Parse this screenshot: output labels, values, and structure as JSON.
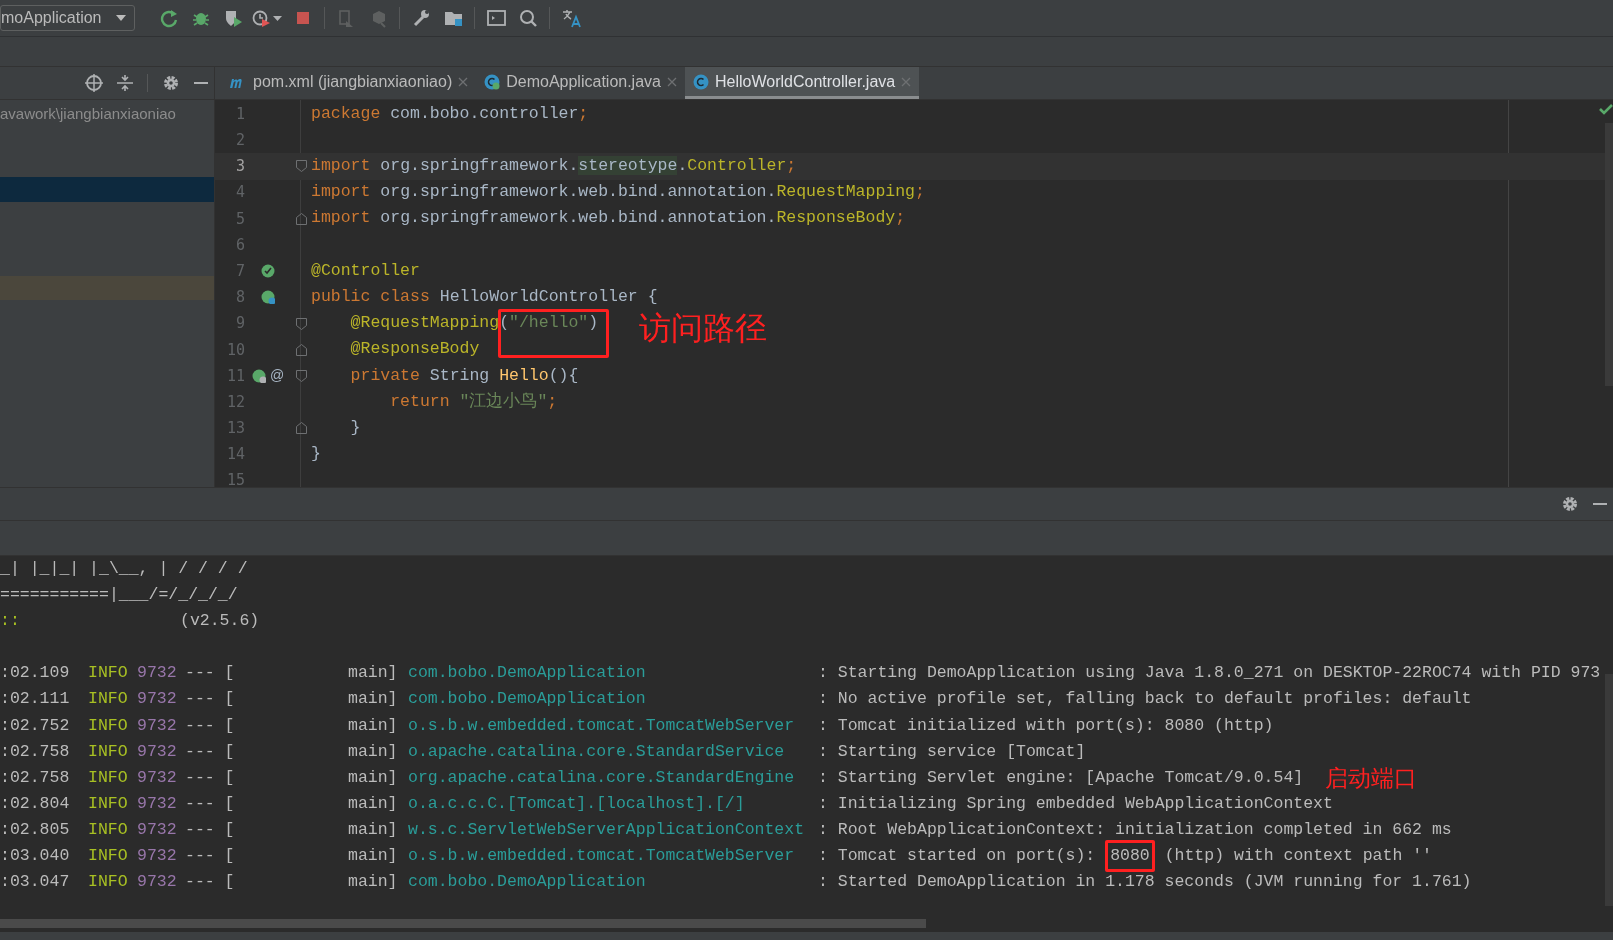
{
  "toolbar": {
    "run_config": "moApplication",
    "tools": [
      {
        "kind": "rerun"
      },
      {
        "kind": "debug"
      },
      {
        "kind": "coverage"
      },
      {
        "kind": "profile"
      },
      {
        "kind": "stop"
      },
      {
        "kind": "sep"
      },
      {
        "kind": "attach"
      },
      {
        "kind": "deploy"
      },
      {
        "kind": "sep"
      },
      {
        "kind": "wrench"
      },
      {
        "kind": "folder"
      },
      {
        "kind": "sep"
      },
      {
        "kind": "terminal"
      },
      {
        "kind": "search"
      },
      {
        "kind": "sep"
      },
      {
        "kind": "translate"
      }
    ]
  },
  "project_panel": {
    "path": "avawork\\jiangbianxiaoniao"
  },
  "tabs": [
    {
      "label": "pom.xml (jiangbianxiaoniao)",
      "kind": "maven",
      "selected": false
    },
    {
      "label": "DemoApplication.java",
      "kind": "app",
      "selected": false
    },
    {
      "label": "HelloWorldController.java",
      "kind": "class",
      "selected": true
    }
  ],
  "code": [
    {
      "number": "1",
      "current": false,
      "tokens": [
        {
          "kind": "keyword",
          "text": "package"
        },
        {
          "kind": "plain",
          "text": " com.bobo.controller"
        },
        {
          "kind": "keyword",
          "text": ";"
        }
      ]
    },
    {
      "number": "2",
      "current": false
    },
    {
      "number": "3",
      "current": true,
      "markers": [
        {
          "kind": "fold-start"
        }
      ],
      "tokens": [
        {
          "kind": "keyword",
          "text": "import"
        },
        {
          "kind": "plain",
          "text": " org.springframework."
        },
        {
          "kind": "match",
          "text": "stereotype"
        },
        {
          "kind": "plain",
          "text": "."
        },
        {
          "kind": "type",
          "text": "Controller"
        },
        {
          "kind": "keyword",
          "text": ";"
        }
      ]
    },
    {
      "number": "4",
      "current": false,
      "tokens": [
        {
          "kind": "keyword",
          "text": "import"
        },
        {
          "kind": "plain",
          "text": " org.springframework.web.bind.annotation."
        },
        {
          "kind": "type",
          "text": "RequestMapping"
        },
        {
          "kind": "keyword",
          "text": ";"
        }
      ]
    },
    {
      "number": "5",
      "current": false,
      "markers": [
        {
          "kind": "fold-end"
        }
      ],
      "tokens": [
        {
          "kind": "keyword",
          "text": "import"
        },
        {
          "kind": "plain",
          "text": " org.springframework.web.bind.annotation."
        },
        {
          "kind": "type",
          "text": "ResponseBody"
        },
        {
          "kind": "keyword",
          "text": ";"
        }
      ]
    },
    {
      "number": "6",
      "current": false
    },
    {
      "number": "7",
      "current": false,
      "markers": [
        {
          "kind": "bean-check"
        }
      ],
      "tokens": [
        {
          "kind": "annotation",
          "text": "@Controller"
        }
      ]
    },
    {
      "number": "8",
      "current": false,
      "markers": [
        {
          "kind": "bean"
        }
      ],
      "tokens": [
        {
          "kind": "keyword",
          "text": "public class "
        },
        {
          "kind": "plain",
          "text": "HelloWorldController {"
        }
      ]
    },
    {
      "number": "9",
      "current": false,
      "markers": [
        {
          "kind": "fold-start"
        }
      ],
      "tokens": [
        {
          "kind": "annotation",
          "text": "    @RequestMapping"
        },
        {
          "kind": "plain",
          "text": "("
        },
        {
          "kind": "string",
          "text": "\"/hello\""
        },
        {
          "kind": "plain",
          "text": ")"
        }
      ]
    },
    {
      "number": "10",
      "current": false,
      "markers": [
        {
          "kind": "fold-end"
        }
      ],
      "tokens": [
        {
          "kind": "annotation",
          "text": "    @ResponseBody"
        }
      ]
    },
    {
      "number": "11",
      "current": false,
      "markers": [
        {
          "kind": "bean-web"
        },
        {
          "kind": "fold-start"
        }
      ],
      "gutter_text": "@",
      "tokens": [
        {
          "kind": "keyword",
          "text": "    private "
        },
        {
          "kind": "plain",
          "text": "String "
        },
        {
          "kind": "method",
          "text": "Hello"
        },
        {
          "kind": "plain",
          "text": "(){"
        }
      ]
    },
    {
      "number": "12",
      "current": false,
      "tokens": [
        {
          "kind": "keyword",
          "text": "        return "
        },
        {
          "kind": "string",
          "text": "\"江边小鸟\""
        },
        {
          "kind": "keyword",
          "text": ";"
        }
      ]
    },
    {
      "number": "13",
      "current": false,
      "markers": [
        {
          "kind": "fold-end"
        }
      ],
      "tokens": [
        {
          "kind": "plain",
          "text": "    }"
        }
      ]
    },
    {
      "number": "14",
      "current": false,
      "tokens": [
        {
          "kind": "plain",
          "text": "}"
        }
      ]
    },
    {
      "number": "15",
      "current": false
    }
  ],
  "annotations": [
    {
      "kind": "code",
      "label": "访问路径"
    },
    {
      "kind": "console",
      "label": "启动端口"
    }
  ],
  "console": {
    "banner": [
      "_| |_|_| |_\\__, | / / / /",
      "===========|___/=/_/_/_/"
    ],
    "version_prefix": "::",
    "version": "(v2.5.6)",
    "logs": [
      {
        "time": ":02.109",
        "level": "INFO",
        "pid": "9732",
        "sep": "--- [",
        "thread": "main]",
        "logger": "com.bobo.DemoApplication",
        "message": ": Starting DemoApplication using Java 1.8.0_271 on DESKTOP-22ROC74 with PID 973"
      },
      {
        "time": ":02.111",
        "level": "INFO",
        "pid": "9732",
        "sep": "--- [",
        "thread": "main]",
        "logger": "com.bobo.DemoApplication",
        "message": ": No active profile set, falling back to default profiles: default"
      },
      {
        "time": ":02.752",
        "level": "INFO",
        "pid": "9732",
        "sep": "--- [",
        "thread": "main]",
        "logger": "o.s.b.w.embedded.tomcat.TomcatWebServer",
        "message": ": Tomcat initialized with port(s): 8080 (http)"
      },
      {
        "time": ":02.758",
        "level": "INFO",
        "pid": "9732",
        "sep": "--- [",
        "thread": "main]",
        "logger": "o.apache.catalina.core.StandardService",
        "message": ": Starting service [Tomcat]"
      },
      {
        "time": ":02.758",
        "level": "INFO",
        "pid": "9732",
        "sep": "--- [",
        "thread": "main]",
        "logger": "org.apache.catalina.core.StandardEngine",
        "message": ": Starting Servlet engine: [Apache Tomcat/9.0.54]"
      },
      {
        "time": ":02.804",
        "level": "INFO",
        "pid": "9732",
        "sep": "--- [",
        "thread": "main]",
        "logger": "o.a.c.c.C.[Tomcat].[localhost].[/]",
        "message": ": Initializing Spring embedded WebApplicationContext"
      },
      {
        "time": ":02.805",
        "level": "INFO",
        "pid": "9732",
        "sep": "--- [",
        "thread": "main]",
        "logger": "w.s.c.ServletWebServerApplicationContext",
        "message": ": Root WebApplicationContext: initialization completed in 662 ms"
      },
      {
        "time": ":03.040",
        "level": "INFO",
        "pid": "9732",
        "sep": "--- [",
        "thread": "main]",
        "logger": "o.s.b.w.embedded.tomcat.TomcatWebServer",
        "message": ": Tomcat started on port(s): ",
        "boxed": "8080",
        "message_after": " (http) with context path ''"
      },
      {
        "time": ":03.047",
        "level": "INFO",
        "pid": "9732",
        "sep": "--- [",
        "thread": "main]",
        "logger": "com.bobo.DemoApplication",
        "message": ": Started DemoApplication in 1.178 seconds (JVM running for 1.761)"
      }
    ]
  }
}
